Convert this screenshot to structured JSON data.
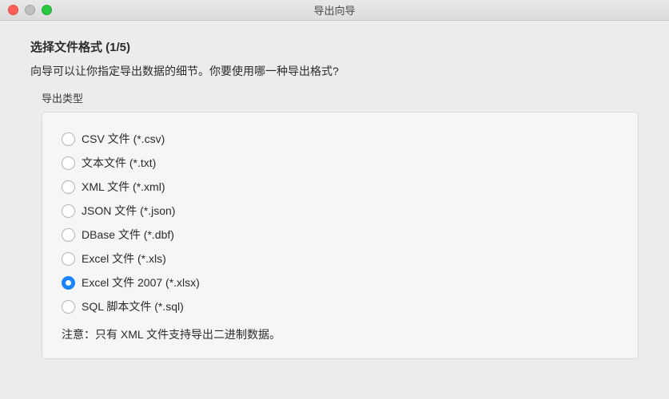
{
  "window": {
    "title": "导出向导"
  },
  "step": {
    "title": "选择文件格式 (1/5)",
    "subtitle": "向导可以让你指定导出数据的细节。你要使用哪一种导出格式?",
    "group_label": "导出类型",
    "note": "注意：只有 XML 文件支持导出二进制数据。"
  },
  "options": [
    {
      "label": "CSV 文件 (*.csv)",
      "selected": false
    },
    {
      "label": "文本文件 (*.txt)",
      "selected": false
    },
    {
      "label": "XML 文件 (*.xml)",
      "selected": false
    },
    {
      "label": "JSON 文件 (*.json)",
      "selected": false
    },
    {
      "label": "DBase 文件 (*.dbf)",
      "selected": false
    },
    {
      "label": "Excel 文件 (*.xls)",
      "selected": false
    },
    {
      "label": "Excel 文件 2007 (*.xlsx)",
      "selected": true
    },
    {
      "label": "SQL 脚本文件 (*.sql)",
      "selected": false
    }
  ]
}
